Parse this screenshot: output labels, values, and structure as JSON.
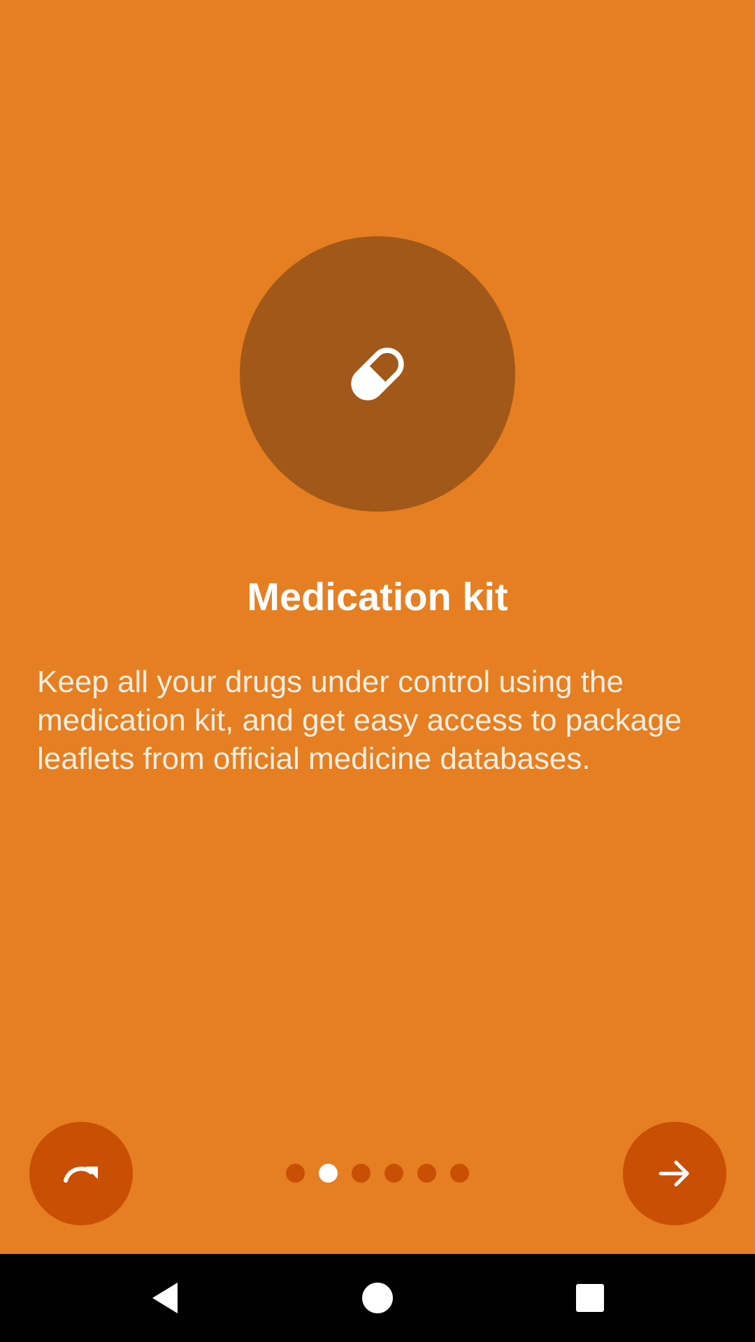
{
  "slide": {
    "icon": "pill-icon",
    "title": "Medication kit",
    "description": "Keep all your drugs under control using the medication kit, and get easy access to package leaflets from official medicine databases."
  },
  "pager": {
    "total": 6,
    "current_index": 1
  },
  "buttons": {
    "skip_icon": "redo-arrow-icon",
    "next_icon": "arrow-right-icon"
  },
  "navbar": {
    "back_icon": "back-triangle-icon",
    "home_icon": "home-circle-icon",
    "recents_icon": "recents-square-icon"
  },
  "colors": {
    "background": "#e57f22",
    "icon_circle": "#a25818",
    "button": "#c94f04",
    "dot_inactive": "#c94f04",
    "dot_active": "#ffffff"
  }
}
